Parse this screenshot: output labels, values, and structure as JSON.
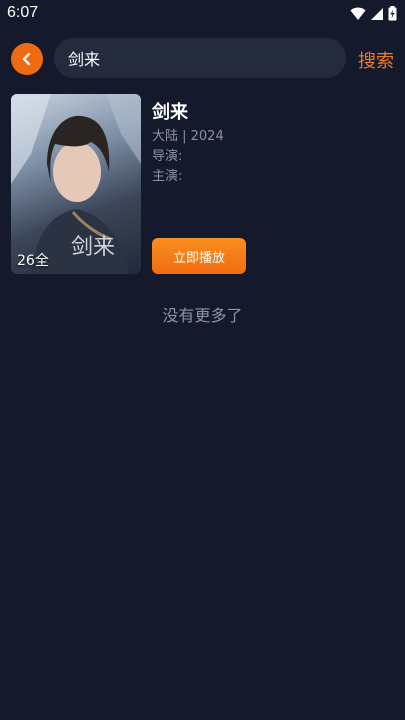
{
  "status_bar": {
    "time": "6:07"
  },
  "search": {
    "query": "剑来",
    "submit_label": "搜索"
  },
  "results": [
    {
      "title": "剑来",
      "region_year": "大陆 | 2024",
      "director_label": "导演:",
      "cast_label": "主演:",
      "episode_badge": "26全",
      "play_label": "立即播放"
    }
  ],
  "footer": {
    "no_more": "没有更多了"
  },
  "colors": {
    "background": "#141a2b",
    "accent": "#f57a1e",
    "search_bg": "#232b3d",
    "muted_text": "#8a93a5"
  }
}
